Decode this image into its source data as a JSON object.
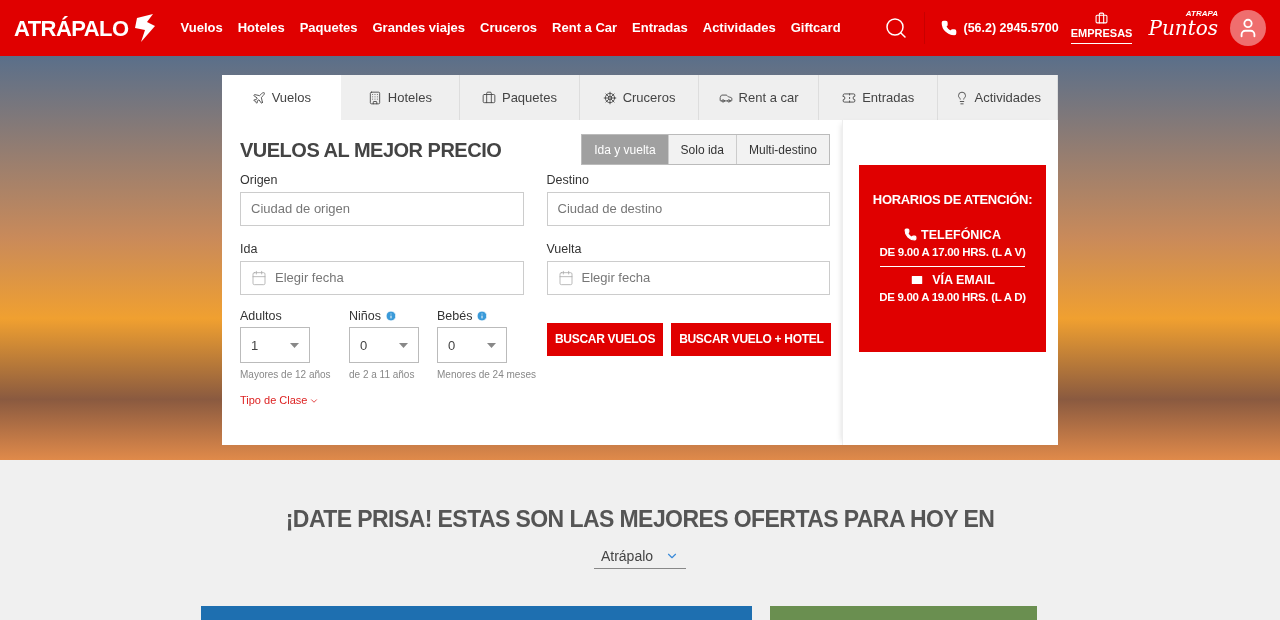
{
  "header": {
    "logo": "ATRÁPALO",
    "nav": [
      "Vuelos",
      "Hoteles",
      "Paquetes",
      "Grandes viajes",
      "Cruceros",
      "Rent a Car",
      "Entradas",
      "Actividades",
      "Giftcard"
    ],
    "phone": "(56.2) 2945.5700",
    "empresas": "EMPRESAS",
    "puntos_top": "ATRAPA",
    "puntos": "Puntos"
  },
  "tabs": [
    {
      "label": "Vuelos",
      "kind": "plane",
      "selected": true
    },
    {
      "label": "Hoteles",
      "kind": "building",
      "selected": false
    },
    {
      "label": "Paquetes",
      "kind": "luggage",
      "selected": false
    },
    {
      "label": "Cruceros",
      "kind": "wheel",
      "selected": false
    },
    {
      "label": "Rent a car",
      "kind": "car",
      "selected": false
    },
    {
      "label": "Entradas",
      "kind": "ticket",
      "selected": false
    },
    {
      "label": "Actividades",
      "kind": "balloon",
      "selected": false
    }
  ],
  "form": {
    "title": "VUELOS AL MEJOR PRECIO",
    "trip_types": [
      {
        "label": "Ida y vuelta",
        "selected": true
      },
      {
        "label": "Solo ida",
        "selected": false
      },
      {
        "label": "Multi-destino",
        "selected": false
      }
    ],
    "fields": [
      {
        "label": "Origen",
        "placeholder": "Ciudad de origen",
        "kind": "text"
      },
      {
        "label": "Destino",
        "placeholder": "Ciudad de destino",
        "kind": "text"
      },
      {
        "label": "Ida",
        "placeholder": "Elegir fecha",
        "kind": "date"
      },
      {
        "label": "Vuelta",
        "placeholder": "Elegir fecha",
        "kind": "date"
      }
    ],
    "passengers": [
      {
        "label": "Adultos",
        "value": "1",
        "hint": "Mayores de 12 años",
        "info": false
      },
      {
        "label": "Niños",
        "value": "0",
        "hint": "de 2 a 11 años",
        "info": true
      },
      {
        "label": "Bebés",
        "value": "0",
        "hint": "Menores de 24 meses",
        "info": true
      }
    ],
    "buttons": [
      "BUSCAR VUELOS",
      "BUSCAR VUELO + HOTEL"
    ],
    "class_link": "Tipo de Clase"
  },
  "info_box": {
    "title": "HORARIOS DE ATENCIÓN:",
    "phone_label": "TELEFÓNICA",
    "phone_hours": "DE 9.00 A 17.00 HRS. (L A V)",
    "email_label": "VÍA EMAIL",
    "email_hours": "DE 9.00 A 19.00 HRS. (L A D)"
  },
  "offers": {
    "title": "¡DATE PRISA! ESTAS SON LAS MEJORES OFERTAS PARA HOY EN",
    "selector": "Atrápalo"
  }
}
